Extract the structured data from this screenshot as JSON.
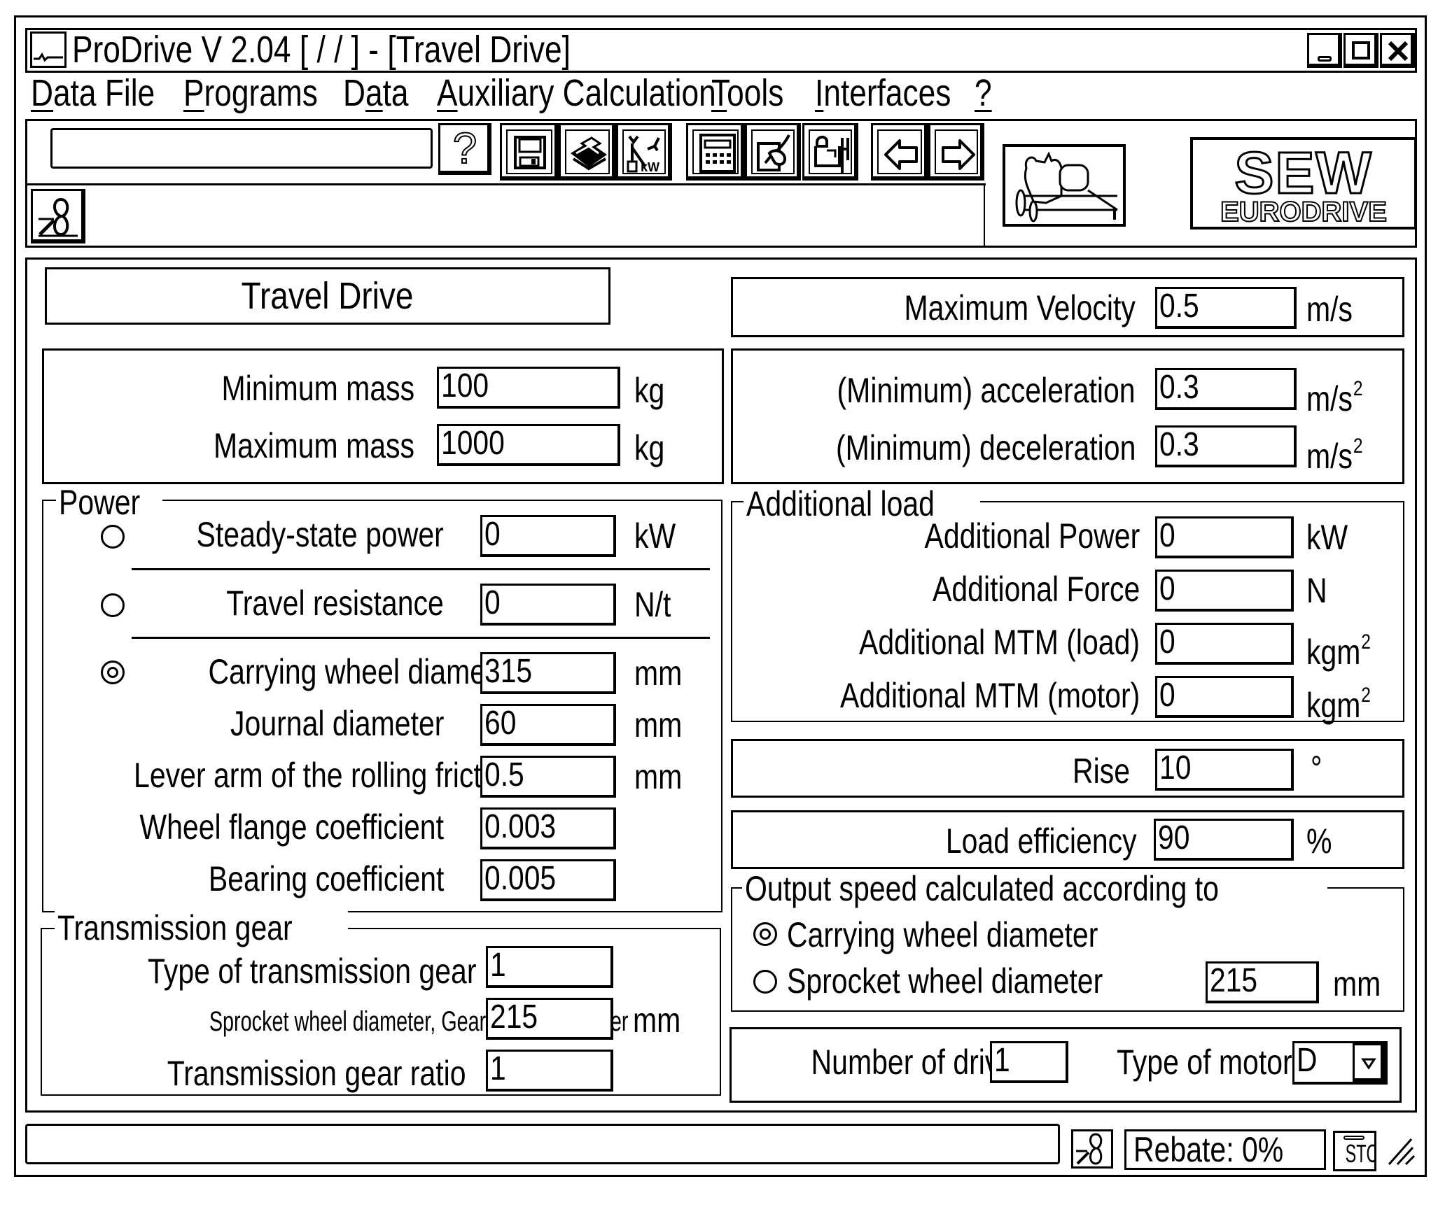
{
  "window": {
    "title": "ProDrive V 2.04 [ / / ] - [Travel Drive]",
    "controls": {
      "minimize": "_",
      "maximize": "□",
      "close": "X"
    }
  },
  "menu": [
    {
      "label": "Data File",
      "accel": "D",
      "rest": "ata File"
    },
    {
      "label": "Programs",
      "accel": "P",
      "rest": "rograms"
    },
    {
      "label": "Data",
      "pre": "D",
      "accel": "a",
      "rest": "ta"
    },
    {
      "label": "Auxiliary Calculation",
      "accel": "A",
      "rest": "uxiliary Calculation"
    },
    {
      "label": "Tools",
      "accel": "T",
      "rest": "ools"
    },
    {
      "label": "Interfaces",
      "accel": "I",
      "rest": "nterfaces"
    },
    {
      "label": "?",
      "accel": "?",
      "rest": ""
    }
  ],
  "toolbar": {
    "input_value": "",
    "buttons": [
      {
        "name": "help",
        "icon": "question-mark-icon",
        "glyph": "?"
      },
      {
        "name": "save",
        "icon": "floppy-disk-icon"
      },
      {
        "name": "print",
        "icon": "printer-icon"
      },
      {
        "name": "drive-selection",
        "icon": "drive-kw-icon",
        "glyph": "kW"
      },
      {
        "name": "calculator",
        "icon": "calculator-icon"
      },
      {
        "name": "edit",
        "icon": "pen-hand-icon"
      },
      {
        "name": "gear-unit",
        "icon": "gear-unit-icon"
      },
      {
        "name": "back",
        "icon": "arrow-left-icon"
      },
      {
        "name": "forward",
        "icon": "arrow-right-icon"
      }
    ]
  },
  "logo": {
    "line1": "SEW",
    "line2": "EURODRIVE"
  },
  "form": {
    "title": "Travel Drive",
    "mass": {
      "min_label": "Minimum mass",
      "min_value": "100",
      "min_unit": "kg",
      "max_label": "Maximum mass",
      "max_value": "1000",
      "max_unit": "kg"
    },
    "power": {
      "legend": "Power",
      "steady_state": {
        "label": "Steady-state power",
        "value": "0",
        "unit": "kW",
        "selected": false
      },
      "travel_resistance": {
        "label": "Travel resistance",
        "value": "0",
        "unit": "N/t",
        "selected": false
      },
      "carrying_wheel": {
        "label": "Carrying wheel diameter",
        "value": "315",
        "unit": "mm",
        "selected": true
      },
      "journal": {
        "label": "Journal diameter",
        "value": "60",
        "unit": "mm"
      },
      "lever_arm": {
        "label": "Lever arm of the rolling friction",
        "value": "0.5",
        "unit": "mm"
      },
      "wheel_flange": {
        "label": "Wheel flange coefficient",
        "value": "0.003"
      },
      "bearing": {
        "label": "Bearing coefficient",
        "value": "0.005"
      }
    },
    "transmission": {
      "legend": "Transmission gear",
      "type": {
        "label": "Type of transmission gear",
        "value": "1"
      },
      "sprocket": {
        "label": "Sprocket wheel diameter, Gear wheel diameter",
        "value": "215",
        "unit": "mm"
      },
      "ratio": {
        "label": "Transmission gear ratio",
        "value": "1"
      }
    },
    "velocity": {
      "label": "Maximum Velocity",
      "value": "0.5",
      "unit": "m/s"
    },
    "accel": {
      "acc_label": "(Minimum) acceleration",
      "acc_value": "0.3",
      "acc_unit": "m/s",
      "acc_sup": "2",
      "dec_label": "(Minimum) deceleration",
      "dec_value": "0.3",
      "dec_unit": "m/s",
      "dec_sup": "2"
    },
    "additional_load": {
      "legend": "Additional load",
      "power": {
        "label": "Additional Power",
        "value": "0",
        "unit": "kW"
      },
      "force": {
        "label": "Additional Force",
        "value": "0",
        "unit": "N"
      },
      "mtm_load": {
        "label": "Additional MTM (load)",
        "value": "0",
        "unit": "kgm",
        "sup": "2"
      },
      "mtm_motor": {
        "label": "Additional MTM (motor)",
        "value": "0",
        "unit": "kgm",
        "sup": "2"
      }
    },
    "rise": {
      "label": "Rise",
      "value": "10",
      "unit": "°"
    },
    "load_efficiency": {
      "label": "Load efficiency",
      "value": "90",
      "unit": "%"
    },
    "output_speed": {
      "legend": "Output speed calculated according to",
      "carrying": {
        "label": "Carrying wheel diameter",
        "selected": true
      },
      "sprocket": {
        "label": "Sprocket wheel diameter",
        "selected": false,
        "value": "215",
        "unit": "mm"
      }
    },
    "drives": {
      "label": "Number of drives",
      "value": "1"
    },
    "motor": {
      "label": "Type of motor",
      "value": "D"
    }
  },
  "status": {
    "message": "",
    "rebate": "Rebate: 0%",
    "stc": "STC"
  }
}
